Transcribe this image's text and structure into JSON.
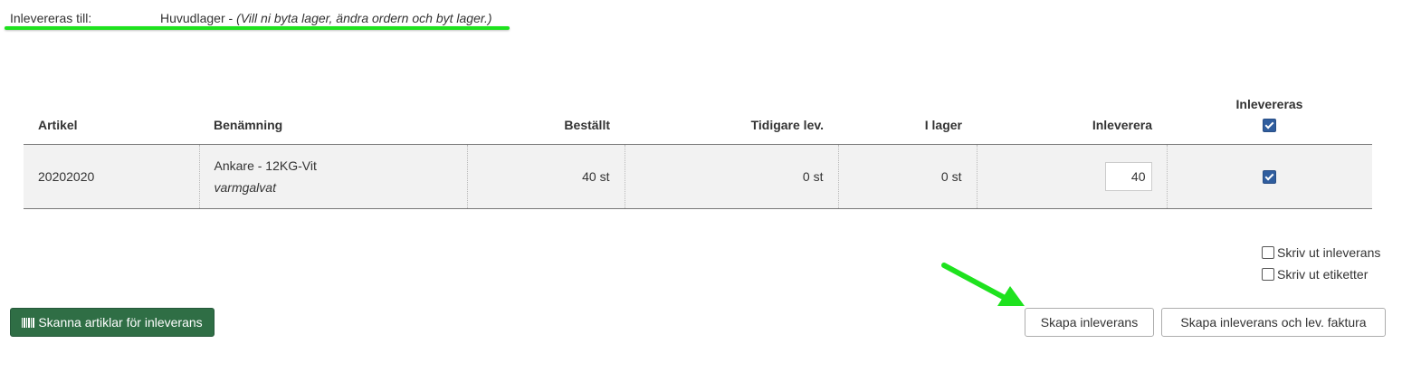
{
  "delivery": {
    "label": "Inlevereras till:",
    "warehouse": "Huvudlager",
    "separator": " - ",
    "note": "(Vill ni byta lager, ändra ordern och byt lager.)"
  },
  "table": {
    "headers": {
      "article": "Artikel",
      "name": "Benämning",
      "ordered": "Beställt",
      "previously_delivered": "Tidigare lev.",
      "in_stock": "I lager",
      "deliver": "Inleverera",
      "to_deliver": "Inlevereras"
    },
    "header_checkbox_checked": true,
    "rows": [
      {
        "article": "20202020",
        "name": "Ankare - 12KG-Vit",
        "description": "varmgalvat",
        "ordered": "40 st",
        "previously_delivered": "0 st",
        "in_stock": "0 st",
        "deliver_value": "40",
        "checked": true
      }
    ]
  },
  "print_options": [
    {
      "label": "Skriv ut inleverans",
      "checked": false
    },
    {
      "label": "Skriv ut etiketter",
      "checked": false
    }
  ],
  "buttons": {
    "scan": "Skanna artiklar för inleverans",
    "create": "Skapa inleverans",
    "create_with_invoice": "Skapa inleverans och lev. faktura"
  },
  "icons": {
    "scan_icon": "barcode-icon",
    "annotation_arrow": "arrow-icon"
  },
  "colors": {
    "highlight": "#1ee21e",
    "scan_button": "#2f6e45",
    "checkbox": "#2f5d9e"
  }
}
